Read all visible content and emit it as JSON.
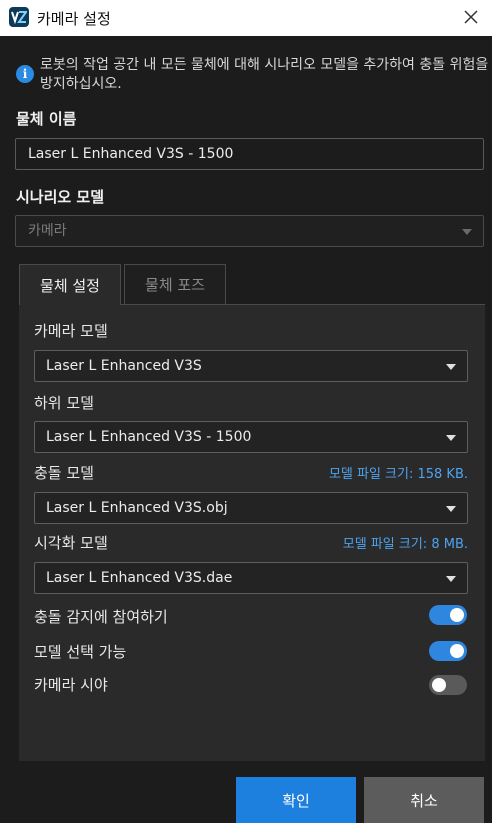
{
  "window": {
    "title": "카메라 설정",
    "app_icon_text": "VZ"
  },
  "notice": {
    "text": "로봇의 작업 공간 내 모든 물체에 대해 시나리오 모델을 추가하여 충돌 위험을 방지하십시오."
  },
  "object_name": {
    "label": "물체 이름",
    "value": "Laser L Enhanced V3S - 1500"
  },
  "scenario_model": {
    "label": "시나리오 모델",
    "value": "카메라"
  },
  "tabs": [
    {
      "label": "물체 설정",
      "active": true
    },
    {
      "label": "물체 포즈",
      "active": false
    }
  ],
  "settings": {
    "camera_model": {
      "label": "카메라 모델",
      "value": "Laser L Enhanced V3S"
    },
    "sub_model": {
      "label": "하위 모델",
      "value": "Laser L Enhanced V3S - 1500"
    },
    "collision_model": {
      "label": "충돌 모델",
      "size_text": "모델 파일 크기: 158 KB.",
      "value": "Laser L Enhanced V3S.obj"
    },
    "visual_model": {
      "label": "시각화 모델",
      "size_text": "모델 파일 크기: 8 MB.",
      "value": "Laser L Enhanced V3S.dae"
    },
    "toggles": [
      {
        "label": "충돌 감지에 참여하기",
        "on": true
      },
      {
        "label": "모델 선택 가능",
        "on": true
      },
      {
        "label": "카메라 시야",
        "on": false
      }
    ]
  },
  "buttons": {
    "ok": "확인",
    "cancel": "취소"
  },
  "colors": {
    "accent": "#1d7fde",
    "toggle_on": "#2f86de",
    "size_text": "#4fa3ee",
    "background": "#1c1c1c",
    "panel": "#2a2a2a"
  }
}
